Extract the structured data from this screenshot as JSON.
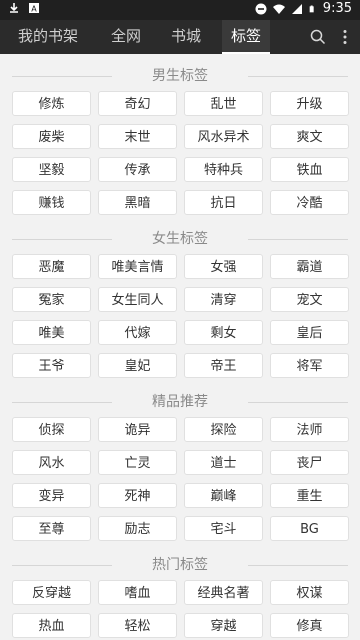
{
  "status": {
    "time": "9:35",
    "icons": [
      "download-icon",
      "app-a-icon",
      "minus-circle-icon",
      "wifi-icon",
      "signal-icon",
      "battery-icon"
    ]
  },
  "tabs": [
    {
      "label": "我的书架",
      "active": false
    },
    {
      "label": "全网",
      "active": false
    },
    {
      "label": "书城",
      "active": false
    },
    {
      "label": "标签",
      "active": true
    }
  ],
  "appbar_icons": [
    "search-icon",
    "more-vertical-icon"
  ],
  "sections": [
    {
      "title": "男生标签",
      "tags": [
        "修炼",
        "奇幻",
        "乱世",
        "升级",
        "废柴",
        "末世",
        "风水异术",
        "爽文",
        "坚毅",
        "传承",
        "特种兵",
        "铁血",
        "赚钱",
        "黑暗",
        "抗日",
        "冷酷"
      ]
    },
    {
      "title": "女生标签",
      "tags": [
        "恶魔",
        "唯美言情",
        "女强",
        "霸道",
        "冤家",
        "女生同人",
        "清穿",
        "宠文",
        "唯美",
        "代嫁",
        "剩女",
        "皇后",
        "王爷",
        "皇妃",
        "帝王",
        "将军"
      ]
    },
    {
      "title": "精品推荐",
      "tags": [
        "侦探",
        "诡异",
        "探险",
        "法师",
        "风水",
        "亡灵",
        "道士",
        "丧尸",
        "变异",
        "死神",
        "巅峰",
        "重生",
        "至尊",
        "励志",
        "宅斗",
        "BG"
      ]
    },
    {
      "title": "热门标签",
      "tags": [
        "反穿越",
        "嗜血",
        "经典名著",
        "权谋",
        "热血",
        "轻松",
        "穿越",
        "修真"
      ]
    }
  ],
  "colors": {
    "statusbar": "#202020",
    "appbar": "#2b2b2b",
    "background": "#f2f2f2",
    "tag_bg": "#ffffff",
    "tag_text": "#333333",
    "section_text": "#8a8a8a"
  }
}
